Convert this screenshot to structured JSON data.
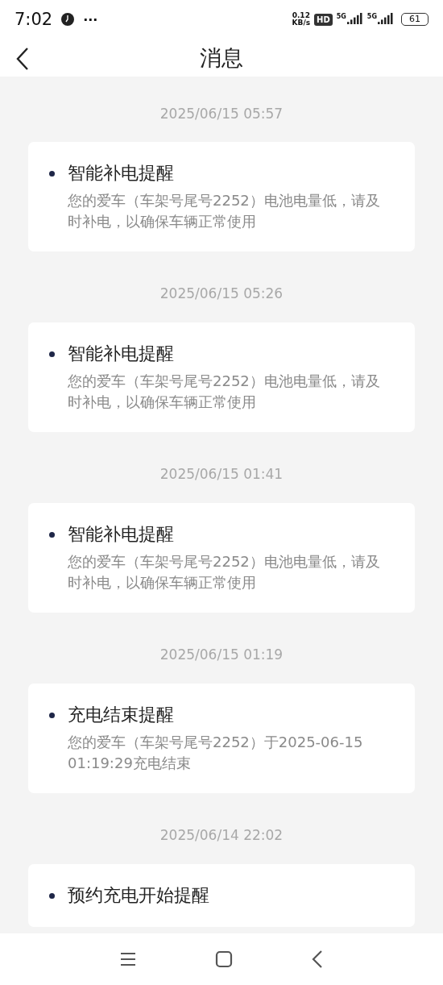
{
  "status_bar": {
    "time": "7:02",
    "more": "···",
    "speed": "0.12",
    "speed_unit": "KB/s",
    "hd": "HD",
    "signals": [
      {
        "label": "5G"
      },
      {
        "label": "5G"
      }
    ],
    "battery": "61"
  },
  "header": {
    "title": "消息"
  },
  "messages": [
    {
      "timestamp": "2025/06/15 05:57",
      "title": "智能补电提醒",
      "body": "您的爱车（车架号尾号2252）电池电量低，请及时补电，以确保车辆正常使用"
    },
    {
      "timestamp": "2025/06/15 05:26",
      "title": "智能补电提醒",
      "body": "您的爱车（车架号尾号2252）电池电量低，请及时补电，以确保车辆正常使用"
    },
    {
      "timestamp": "2025/06/15 01:41",
      "title": "智能补电提醒",
      "body": "您的爱车（车架号尾号2252）电池电量低，请及时补电，以确保车辆正常使用"
    },
    {
      "timestamp": "2025/06/15 01:19",
      "title": "充电结束提醒",
      "body": "您的爱车（车架号尾号2252）于2025-06-15 01:19:29充电结束"
    },
    {
      "timestamp": "2025/06/14 22:02",
      "title": "预约充电开始提醒"
    }
  ]
}
